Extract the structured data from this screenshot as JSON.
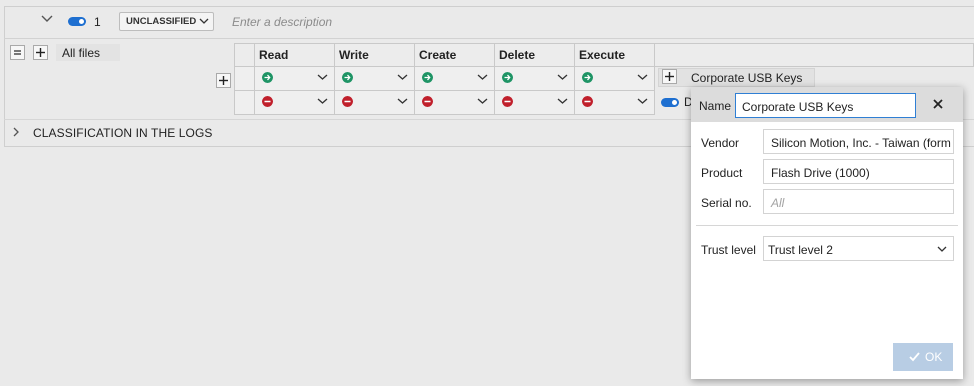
{
  "rule": {
    "number": "1",
    "classification": "UNCLASSIFIED",
    "description_placeholder": "Enter a description"
  },
  "all_files_label": "All files",
  "grid": {
    "columns": [
      "Read",
      "Write",
      "Create",
      "Delete",
      "Execute"
    ],
    "row_allow_icon": "arrow-right-circle-icon",
    "row_deny_icon": "minus-circle-icon",
    "allow_color": "#1e9465",
    "deny_color": "#c01f2b",
    "device_group": "Corporate USB Keys",
    "device_clip": "D"
  },
  "logs_label": "CLASSIFICATION IN THE LOGS",
  "dialog": {
    "name_label": "Name",
    "name_value": "Corporate USB Keys",
    "fields": [
      {
        "label": "Vendor",
        "value": "Silicon Motion, Inc. - Taiwan (form"
      },
      {
        "label": "Product",
        "value": "Flash Drive (1000)"
      },
      {
        "label": "Serial no.",
        "placeholder": "All"
      }
    ],
    "trust_label": "Trust level",
    "trust_value": "Trust level 2",
    "ok_label": "OK"
  },
  "accent_color": "#1e6fd0"
}
